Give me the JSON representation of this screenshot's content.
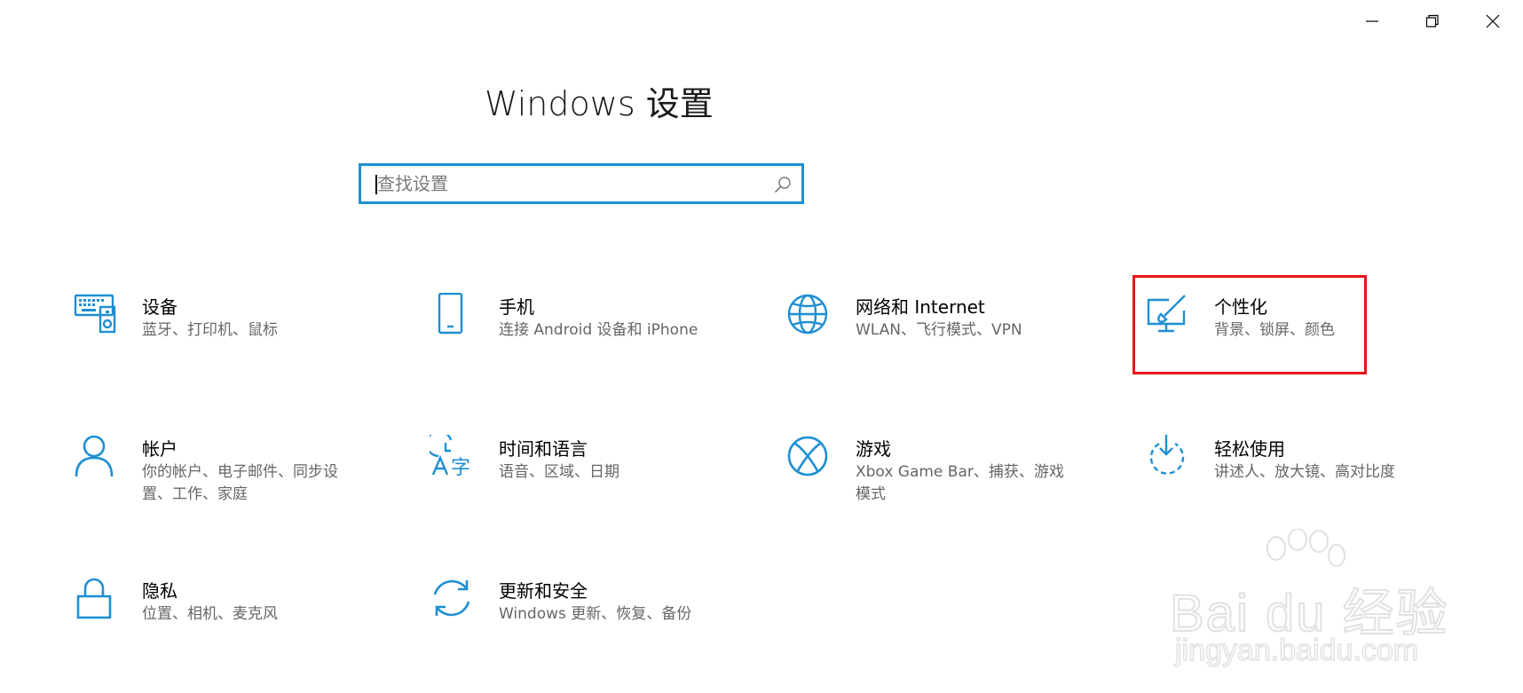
{
  "window": {
    "title": "Windows 设置"
  },
  "search": {
    "placeholder": "查找设置",
    "value": ""
  },
  "tiles": [
    {
      "icon": "devices-icon",
      "title": "设备",
      "desc": "蓝牙、打印机、鼠标"
    },
    {
      "icon": "phone-icon",
      "title": "手机",
      "desc": "连接 Android 设备和 iPhone"
    },
    {
      "icon": "globe-icon",
      "title": "网络和 Internet",
      "desc": "WLAN、飞行模式、VPN"
    },
    {
      "icon": "personalization-icon",
      "title": "个性化",
      "desc": "背景、锁屏、颜色"
    },
    {
      "icon": "person-icon",
      "title": "帐户",
      "desc": "你的帐户、电子邮件、同步设置、工作、家庭"
    },
    {
      "icon": "time-language-icon",
      "title": "时间和语言",
      "desc": "语音、区域、日期"
    },
    {
      "icon": "xbox-icon",
      "title": "游戏",
      "desc": "Xbox Game Bar、捕获、游戏模式"
    },
    {
      "icon": "ease-of-access-icon",
      "title": "轻松使用",
      "desc": "讲述人、放大镜、高对比度"
    },
    {
      "icon": "lock-icon",
      "title": "隐私",
      "desc": "位置、相机、麦克风"
    },
    {
      "icon": "sync-icon",
      "title": "更新和安全",
      "desc": "Windows 更新、恢复、备份"
    }
  ],
  "watermark": {
    "line1": "Bai du 经验",
    "line2": "jingyan.baidu.com"
  },
  "colors": {
    "accent": "#1e8fd2",
    "highlight": "#e8141c",
    "desc_text": "#666666"
  }
}
